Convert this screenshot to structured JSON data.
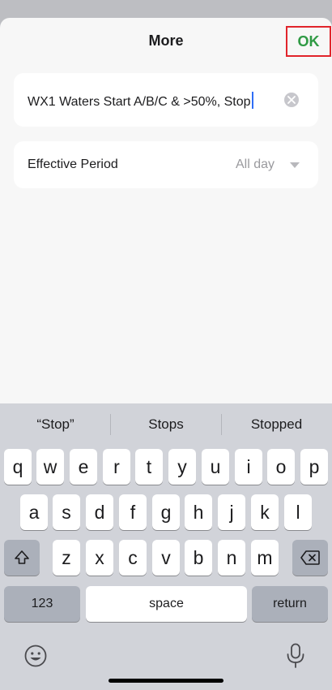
{
  "header": {
    "title": "More",
    "ok_label": "OK"
  },
  "name_field": {
    "value": "WX1 Waters Start A/B/C & >50%, Stop"
  },
  "period": {
    "label": "Effective Period",
    "value": "All day"
  },
  "keyboard": {
    "suggestions": [
      "“Stop”",
      "Stops",
      "Stopped"
    ],
    "row1": [
      "q",
      "w",
      "e",
      "r",
      "t",
      "y",
      "u",
      "i",
      "o",
      "p"
    ],
    "row2": [
      "a",
      "s",
      "d",
      "f",
      "g",
      "h",
      "j",
      "k",
      "l"
    ],
    "row3": [
      "z",
      "x",
      "c",
      "v",
      "b",
      "n",
      "m"
    ],
    "numbers_label": "123",
    "space_label": "space",
    "return_label": "return"
  },
  "colors": {
    "accent_green": "#2f9a44",
    "highlight_red": "#e1242b",
    "caret_blue": "#2f6df6"
  }
}
